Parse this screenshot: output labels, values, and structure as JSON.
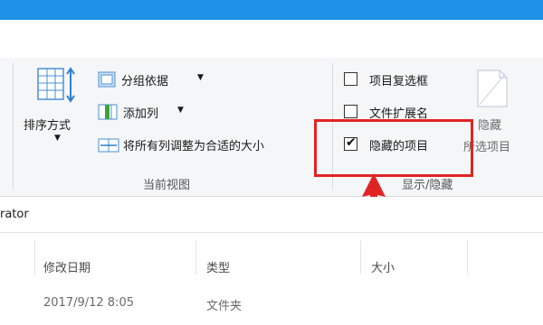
{
  "ribbon": {
    "layout_group": {
      "sort_label": "排序方式",
      "group_by_label": "分组依据",
      "add_column_label": "添加列",
      "fit_columns_label": "将所有列调整为合适的大小",
      "group_caption": "当前视图"
    },
    "show_hide_group": {
      "item_checkboxes_label": "项目复选框",
      "item_checkboxes_checked": false,
      "file_extensions_label": "文件扩展名",
      "file_extensions_checked": false,
      "hidden_items_label": "隐藏的项目",
      "hidden_items_checked": true,
      "hide_selected_line1": "隐藏",
      "hide_selected_line2": "所选项目",
      "group_caption": "显示/隐藏"
    }
  },
  "address_bar": {
    "text": "rator"
  },
  "columns": {
    "date_modified": "修改日期",
    "type": "类型",
    "size": "大小"
  },
  "rows": [
    {
      "date": "2017/9/12 8:05",
      "type": "文件夹"
    }
  ],
  "colors": {
    "titlebar": "#1e90e8",
    "highlight_box": "#e02424",
    "arrow": "#e02424"
  }
}
